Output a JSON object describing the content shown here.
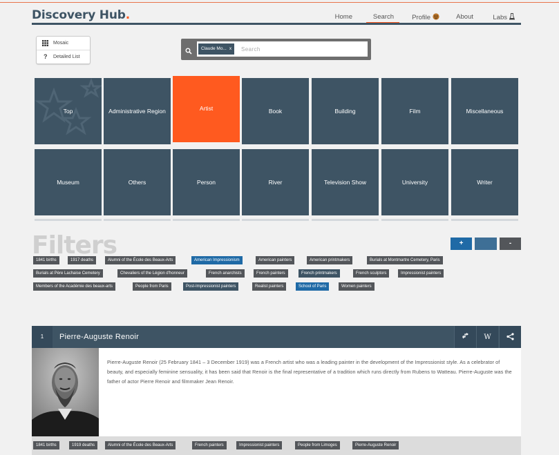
{
  "app": {
    "brand": "Discovery Hub",
    "brand_dot": "."
  },
  "nav": {
    "items": [
      {
        "label": "Home"
      },
      {
        "label": "Search"
      },
      {
        "label": "Profile"
      },
      {
        "label": "About"
      },
      {
        "label": "Labs"
      }
    ]
  },
  "view_toggle": {
    "mosaic": "Mosaic",
    "detailed": "Detailed List"
  },
  "search": {
    "chip": "Claude Mo...",
    "chip_remove": "x",
    "placeholder": "Search"
  },
  "categories": [
    {
      "label": "Top"
    },
    {
      "label": "Administrative Region"
    },
    {
      "label": "Artist"
    },
    {
      "label": "Book"
    },
    {
      "label": "Building"
    },
    {
      "label": "Film"
    },
    {
      "label": "Miscellaneous"
    },
    {
      "label": "Museum"
    },
    {
      "label": "Others"
    },
    {
      "label": "Person"
    },
    {
      "label": "River"
    },
    {
      "label": "Television Show"
    },
    {
      "label": "University"
    },
    {
      "label": "Writer"
    }
  ],
  "filters": {
    "title": "Filters",
    "plus": "+",
    "minus": "-",
    "tags": [
      {
        "label": "1841 births"
      },
      {
        "label": "1917 deaths"
      },
      {
        "label": "Alumni of the École des Beaux-Arts"
      },
      {
        "label": "American Impressionism"
      },
      {
        "label": "American painters"
      },
      {
        "label": "American printmakers"
      },
      {
        "label": "Burials at Montmartre Cemetery, Paris"
      },
      {
        "label": "Burials at Père Lachaise Cemetery"
      },
      {
        "label": "Chevaliers of the Légion d'honneur"
      },
      {
        "label": "French anarchists"
      },
      {
        "label": "French painters"
      },
      {
        "label": "French printmakers"
      },
      {
        "label": "French sculptors"
      },
      {
        "label": "Impressionist painters"
      },
      {
        "label": "Members of the Académie des beaux-arts"
      },
      {
        "label": "People from Paris"
      },
      {
        "label": "Post-Impressionist painters"
      },
      {
        "label": "Realist painters"
      },
      {
        "label": "School of Paris"
      },
      {
        "label": "Women painters"
      }
    ]
  },
  "result": {
    "number": "1",
    "name": "Pierre-Auguste Renoir",
    "wiki_label": "W",
    "bio": "Pierre-Auguste Renoir (25 February 1841 – 3 December 1919) was a French artist who was a leading painter in the development of the Impressionist style. As a celebrator of beauty, and especially feminine sensuality, it has been said that Renoir is the final representative of a tradition which runs directly from Rubens to Watteau. Pierre-Auguste was the father of actor Pierre Renoir and filmmaker Jean Renoir.",
    "tags": [
      {
        "label": "1841 births"
      },
      {
        "label": "1919 deaths"
      },
      {
        "label": "Alumni of the École des Beaux-Arts"
      },
      {
        "label": "French painters"
      },
      {
        "label": "Impressionist painters"
      },
      {
        "label": "People from Limoges"
      },
      {
        "label": "Pierre-Auguste Renoir"
      }
    ]
  },
  "colors": {
    "slate": "#3e5464",
    "accent_orange": "#ff5a1f",
    "selected_blue": "#1f6aa6",
    "tag_gray": "#53565a"
  }
}
